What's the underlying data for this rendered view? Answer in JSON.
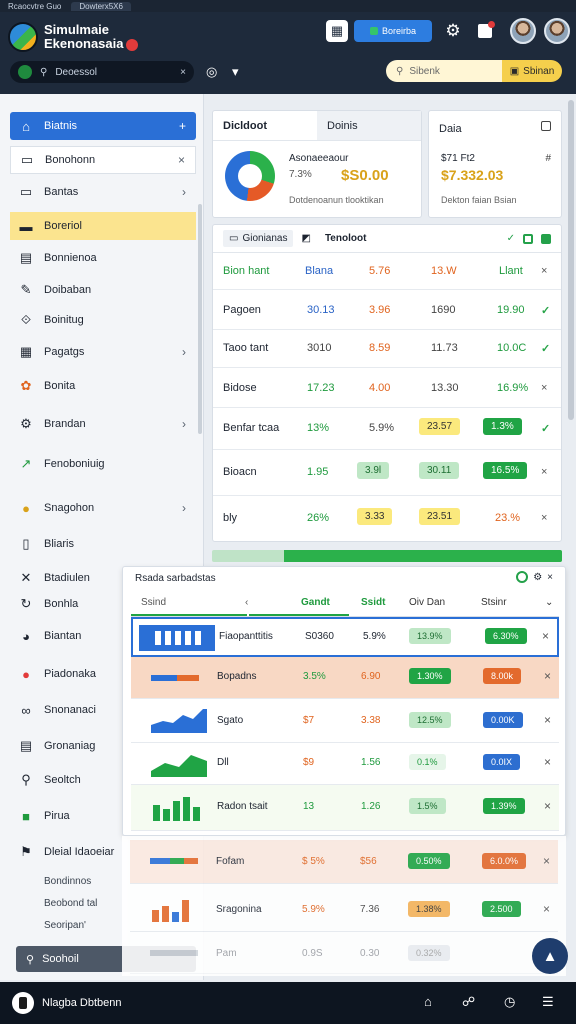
{
  "browser": {
    "tabs": [
      "Rcaocvtre Guo",
      "Dowterx5X6"
    ]
  },
  "header": {
    "brand_line1": "Simulmaie",
    "brand_line2": "Ekenonasaia",
    "primary_button": "Boreirba",
    "search_value": "Deoessol",
    "search_right_placeholder": "Sibenk",
    "search_right_button": "Sbinan"
  },
  "sidebar": {
    "items": [
      {
        "label": "Biatnis",
        "icon": "home-icon",
        "trail": "+"
      },
      {
        "label": "Bonohonn",
        "icon": "user-icon",
        "trail": "×"
      },
      {
        "label": "Bantas",
        "icon": "folder-icon",
        "trail": "›"
      },
      {
        "label": "Boreriol",
        "icon": "folder-icon",
        "trail": ""
      },
      {
        "label": "Bonnienoa",
        "icon": "document-icon",
        "trail": ""
      },
      {
        "label": "Doibaban",
        "icon": "edit-icon",
        "trail": ""
      },
      {
        "label": "Boinitug",
        "icon": "link-icon",
        "trail": ""
      },
      {
        "label": "Pagatgs",
        "icon": "grid-icon",
        "trail": "›"
      },
      {
        "label": "Bonita",
        "icon": "palette-icon",
        "trail": ""
      },
      {
        "label": "Brandan",
        "icon": "gear-icon",
        "trail": "›"
      },
      {
        "label": "Fenoboniuig",
        "icon": "chart-icon",
        "trail": ""
      },
      {
        "label": "Snagohon",
        "icon": "coin-icon",
        "trail": "›"
      },
      {
        "label": "Bliaris",
        "icon": "document-icon",
        "trail": ""
      },
      {
        "label": "Btadiulen",
        "icon": "close-icon",
        "trail": ""
      },
      {
        "label": "Bonhla",
        "icon": "refresh-icon",
        "trail": ""
      },
      {
        "label": "Biantan",
        "icon": "pie-icon",
        "trail": ""
      },
      {
        "label": "Piadonaka",
        "icon": "record-icon",
        "trail": ""
      },
      {
        "label": "Snonanaci",
        "icon": "infinity-icon",
        "trail": ""
      },
      {
        "label": "Gronaniag",
        "icon": "table-icon",
        "trail": ""
      },
      {
        "label": "Seoltch",
        "icon": "search-icon",
        "trail": ""
      },
      {
        "label": "Pirua",
        "icon": "square-icon",
        "trail": ""
      },
      {
        "label": "Dleial Idaoeiar",
        "icon": "flag-icon",
        "trail": ""
      }
    ],
    "sub_items": [
      "Bondinnos",
      "Beobond tal",
      "Seoripan'"
    ],
    "bottom_label": "Soohoil"
  },
  "card_overview": {
    "tab_active": "Dicldoot",
    "tab_inactive": "Doinis",
    "label": "Asonaeeaour",
    "sub": "7.3%",
    "value": "$S0.00",
    "footer": "Dotdenoanun tlooktikan"
  },
  "card_balance": {
    "title": "Daia",
    "label": "$71 Ft2",
    "value": "$7.332.03",
    "icon_text": "#",
    "footer": "Dekton faian Bsian"
  },
  "table1": {
    "tab_label": "Gionianas",
    "title": "Tenoloot",
    "header": [
      "Bion hant",
      "Blana",
      "5.76",
      "13.W",
      "Llant"
    ],
    "rows": [
      {
        "name": "Pagoen",
        "c1": "30.13",
        "c2": "3.96",
        "c3": "1690",
        "c4": "19.90",
        "mark": "✓"
      },
      {
        "name": "Taoo tant",
        "c1": "3010",
        "c2": "8.59",
        "c3": "11.73",
        "c4": "10.0C",
        "mark": "✓"
      },
      {
        "name": "Bidose",
        "c1": "17.23",
        "c2": "4.00",
        "c3": "13.30",
        "c4": "16.9%",
        "mark": "×"
      },
      {
        "name": "Benfar tcaa",
        "c1": "13%",
        "c2": "5.9%",
        "c3": "23.57",
        "c4": "1.3%",
        "mark": "✓"
      },
      {
        "name": "Bioacn",
        "c1": "1.95",
        "c2": "3.9l",
        "c3": "30.11",
        "c4": "16.5%",
        "mark": "×"
      },
      {
        "name": "bly",
        "c1": "26%",
        "c2": "3.33",
        "c3": "23.51",
        "c4": "23.%",
        "mark": "×"
      }
    ]
  },
  "table2": {
    "title": "Rsada sarbadstas",
    "header": [
      "Ssind",
      "Gandt",
      "Ssidt",
      "Oiv Dan",
      "Stsinr"
    ],
    "rows": [
      {
        "name": "Fiaopanttitis",
        "v1": "S0360",
        "v2": "5.9%",
        "chip1": "13.9%",
        "chip2": "6.30%"
      },
      {
        "name": "Bopadns",
        "v1": "3.5%",
        "v2": "6.90",
        "chip1": "1.30%",
        "chip2": "8.00k"
      },
      {
        "name": "Sgato",
        "v1": "$7",
        "v2": "3.38",
        "chip1": "12.5%",
        "chip2": "0.00K"
      },
      {
        "name": "Dll",
        "v1": "$9",
        "v2": "1.56",
        "chip1": "0.1%",
        "chip2": "0.0IX"
      },
      {
        "name": "Radon tsait",
        "v1": "13",
        "v2": "1.26",
        "chip1": "1.5%",
        "chip2": "1.39%"
      },
      {
        "name": "Fofam",
        "v1": "$ 5%",
        "v2": "$56",
        "chip1": "0.50%",
        "chip2": "6.0.0%"
      },
      {
        "name": "Sragonina",
        "v1": "5.9%",
        "v2": "7.36",
        "chip1": "1.38%",
        "chip2": "2.500"
      },
      {
        "name": "Pam",
        "v1": "0.9S",
        "v2": "0.30",
        "chip1": "0.32%",
        "chip2": ""
      }
    ]
  },
  "bottom": {
    "app_name": "Nlagba Dbtbenn"
  },
  "colors": {
    "accent": "#2a6fd6",
    "green": "#20a445",
    "yellow": "#fbe97d",
    "orange": "#e36a2d"
  }
}
